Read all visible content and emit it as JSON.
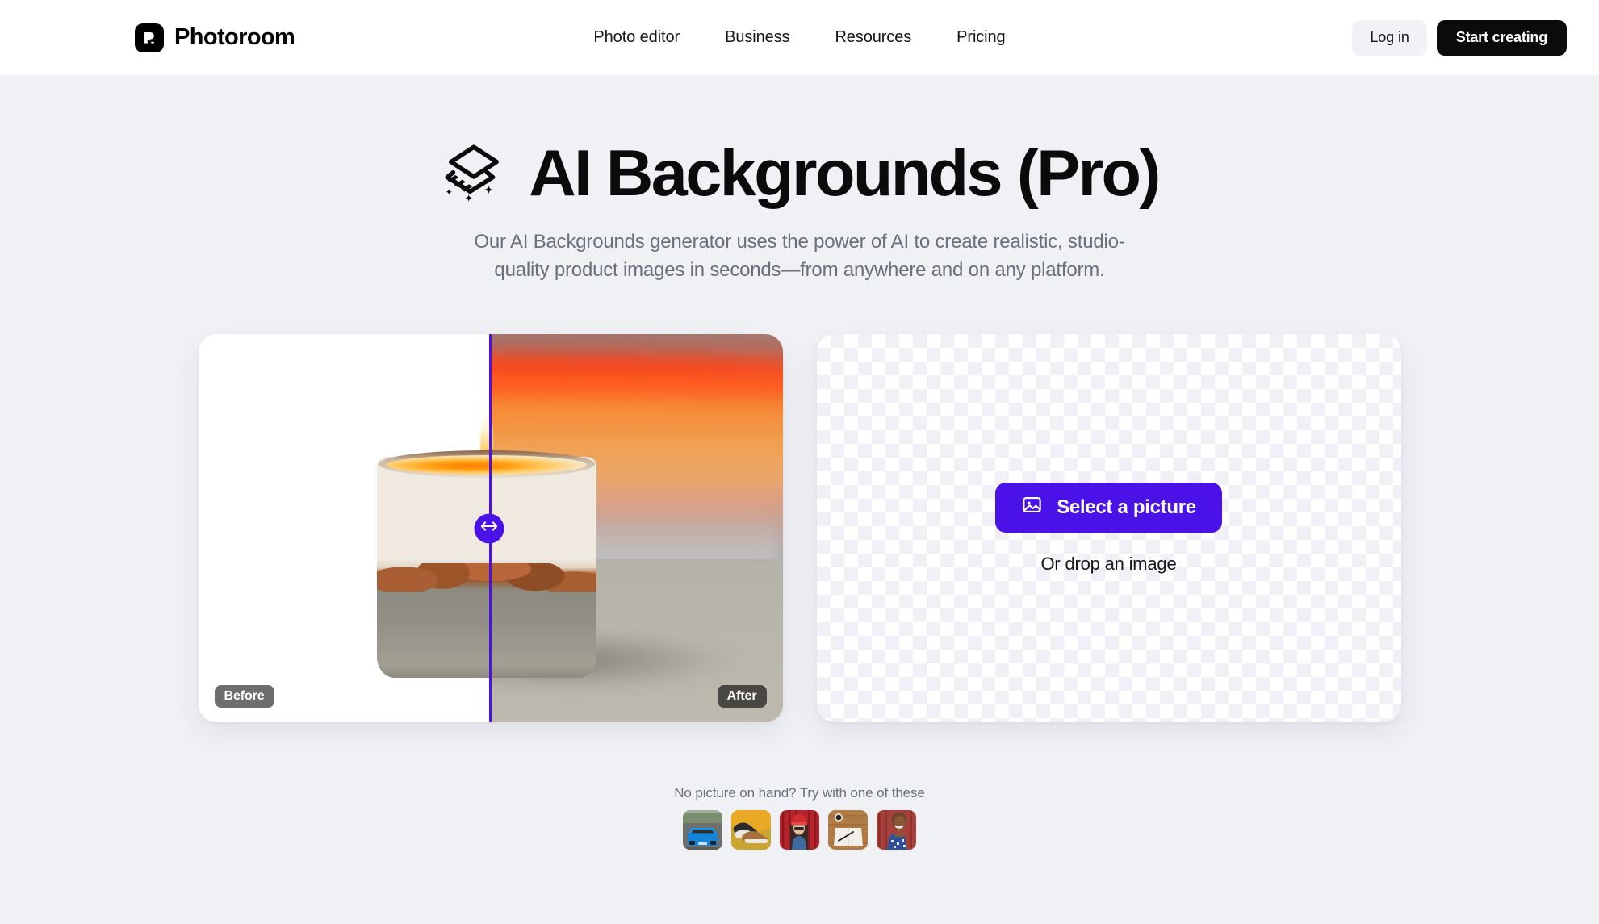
{
  "header": {
    "brand": {
      "name": "Photoroom",
      "logo_icon": "photoroom-logo-icon"
    },
    "nav": [
      {
        "label": "Photo editor"
      },
      {
        "label": "Business"
      },
      {
        "label": "Resources"
      },
      {
        "label": "Pricing"
      }
    ],
    "login_label": "Log in",
    "start_label": "Start creating"
  },
  "hero": {
    "icon": "ai-layers-sparkle-icon",
    "title": "AI Backgrounds (Pro)",
    "subtitle": "Our AI Backgrounds generator uses the power of AI to create realistic, studio-quality product images in seconds—from anywhere and on any platform."
  },
  "compare": {
    "before_label": "Before",
    "after_label": "After",
    "handle_icon": "horizontal-resize-arrows-icon",
    "split_percent": 50,
    "subject": "scented candle in ceramic jar",
    "after_background": "sunset over water"
  },
  "dropzone": {
    "select_label": "Select a picture",
    "select_icon": "image-icon",
    "drop_hint": "Or drop an image"
  },
  "samples": {
    "label": "No picture on hand? Try with one of these",
    "items": [
      {
        "name": "blue-car"
      },
      {
        "name": "brown-sneakers"
      },
      {
        "name": "woman-red-beanie"
      },
      {
        "name": "notebook-on-wood"
      },
      {
        "name": "woman-patterned-top"
      }
    ]
  },
  "colors": {
    "accent": "#4b12e8",
    "page_background": "#f0f1f5",
    "header_background": "#ffffff",
    "text_primary": "#0b0b0c",
    "text_muted": "#6b6f7a",
    "dark_button": "#0b0b0c",
    "light_button": "#f1f2f6"
  }
}
